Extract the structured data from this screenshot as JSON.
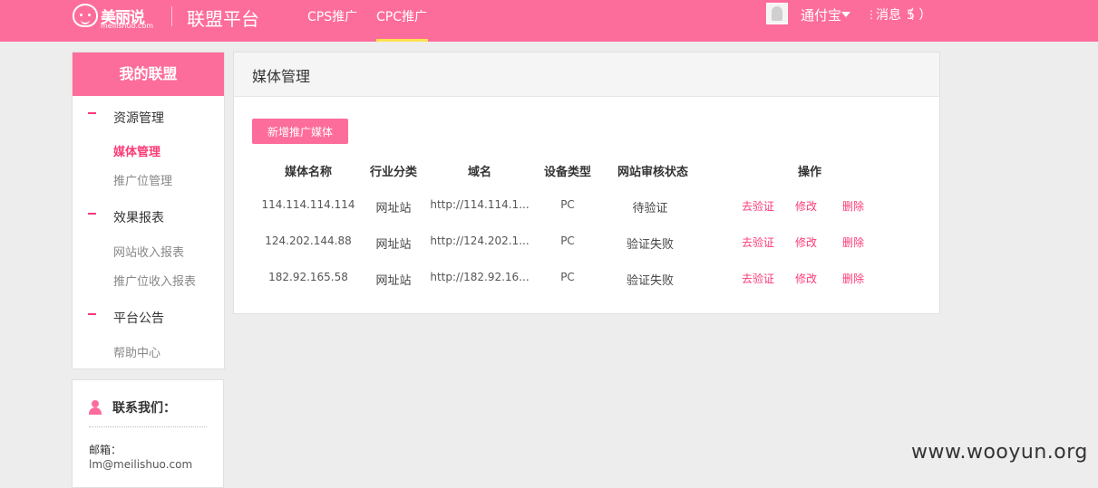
{
  "header": {
    "logo_cn": "美丽说",
    "logo_en": "meilishuo.com",
    "platform_title": "联盟平台",
    "nav": [
      "CPS推广",
      "CPC推广"
    ],
    "active_nav": "CPC推广",
    "user_name": "通付宝",
    "msg_label": "消息（",
    "msg_count": "5 ）"
  },
  "sidebar": {
    "title": "我的联盟",
    "sections": [
      {
        "title": "资源管理",
        "items": [
          "媒体管理",
          "推广位管理"
        ]
      },
      {
        "title": "效果报表",
        "items": [
          "网站收入报表",
          "推广位收入报表"
        ]
      },
      {
        "title": "平台公告",
        "items": [
          "帮助中心"
        ]
      }
    ],
    "active_item": "媒体管理"
  },
  "contact": {
    "title": "联系我们：",
    "email_label": "邮箱：",
    "email": "lm@meilishuo.com"
  },
  "main": {
    "title": "媒体管理",
    "add_button": "新增推广媒体",
    "columns": [
      "媒体名称",
      "行业分类",
      "域名",
      "设备类型",
      "网站审核状态",
      "操作"
    ],
    "rows": [
      {
        "name": "114.114.114.114",
        "category": "网址站",
        "domain": "http://114.114.1...",
        "device": "PC",
        "status": "待验证"
      },
      {
        "name": "124.202.144.88",
        "category": "网址站",
        "domain": "http://124.202.1...",
        "device": "PC",
        "status": "验证失败"
      },
      {
        "name": "182.92.165.58",
        "category": "网址站",
        "domain": "http://182.92.16...",
        "device": "PC",
        "status": "验证失败"
      }
    ],
    "actions": [
      "去验证",
      "修改",
      "删除"
    ]
  },
  "watermark": "www.wooyun.org",
  "colors": {
    "brand_pink": "#fd6d9b",
    "accent_pink": "#fd3b76",
    "nav_underline": "#ffe04d"
  }
}
